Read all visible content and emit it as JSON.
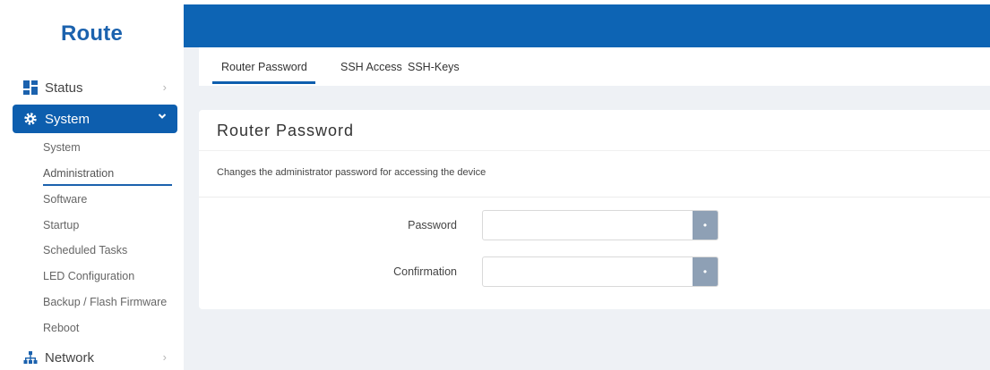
{
  "brand": "Route",
  "sidebar": {
    "status": {
      "label": "Status",
      "icon": "dashboard-icon"
    },
    "system": {
      "label": "System",
      "icon": "gear-icon"
    },
    "system_items": [
      {
        "label": "System"
      },
      {
        "label": "Administration"
      },
      {
        "label": "Software"
      },
      {
        "label": "Startup"
      },
      {
        "label": "Scheduled Tasks"
      },
      {
        "label": "LED Configuration"
      },
      {
        "label": "Backup / Flash Firmware"
      },
      {
        "label": "Reboot"
      }
    ],
    "network": {
      "label": "Network",
      "icon": "network-icon"
    },
    "chevron_right": "›",
    "chevron_down": "⌄"
  },
  "tabs": [
    {
      "label": "Router Password"
    },
    {
      "label": "SSH Access"
    },
    {
      "label": "SSH-Keys"
    }
  ],
  "panel": {
    "title": "Router Password",
    "description": "Changes the administrator password for accessing the device",
    "fields": [
      {
        "label": "Password",
        "value": "",
        "reveal": "•"
      },
      {
        "label": "Confirmation",
        "value": "",
        "reveal": "•"
      }
    ]
  },
  "colors": {
    "accent": "#0d5eae",
    "topbar": "#0d64b4",
    "brand": "#1b62ae"
  }
}
